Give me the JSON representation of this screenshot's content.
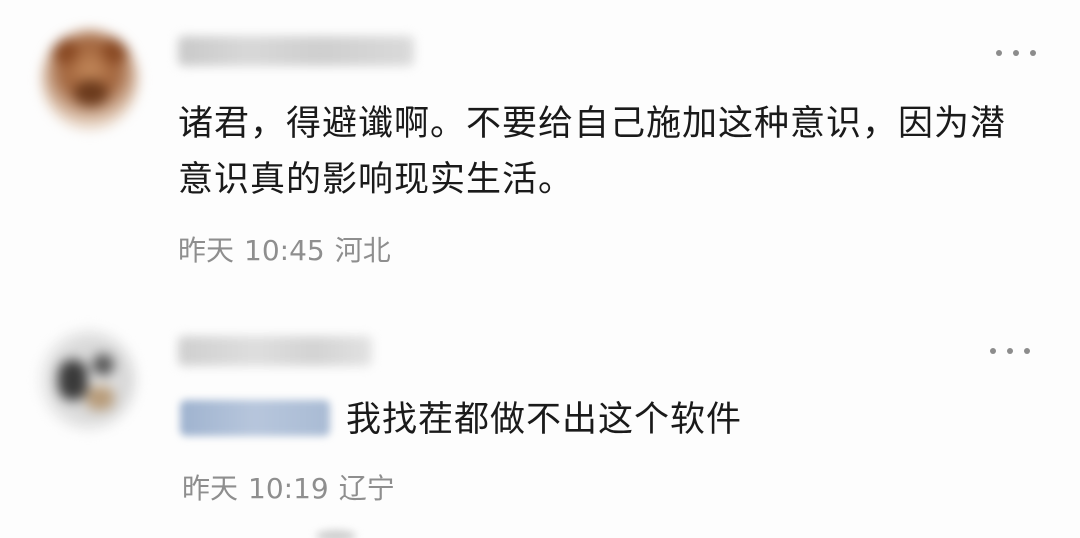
{
  "comments": [
    {
      "content": "诸君，得避谶啊。不要给自己施加这种意识，因为潜意识真的影响现实生活。",
      "date": "昨天",
      "time": "10:45",
      "location": "河北"
    },
    {
      "content": "我找茬都做不出这个软件",
      "date": "昨天",
      "time": "10:19",
      "location": "辽宁"
    }
  ],
  "icons": {
    "more": "more-dots-icon"
  },
  "colors": {
    "content_text": "#1a1a1a",
    "meta_text": "#8e8e8e",
    "more_dots": "#8c8c8c",
    "mention_highlight": "#a9bbd4"
  }
}
